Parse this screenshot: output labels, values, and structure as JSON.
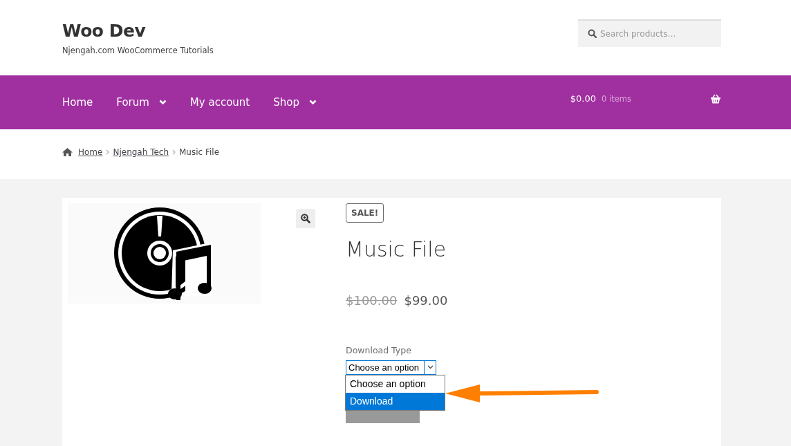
{
  "site": {
    "title": "Woo Dev",
    "tagline": "Njengah.com WooCommerce Tutorials"
  },
  "search": {
    "placeholder": "Search products…"
  },
  "nav": [
    {
      "label": "Home",
      "has_dropdown": false
    },
    {
      "label": "Forum",
      "has_dropdown": true
    },
    {
      "label": "My account",
      "has_dropdown": false
    },
    {
      "label": "Shop",
      "has_dropdown": true
    }
  ],
  "cart": {
    "total": "$0.00",
    "count": "0 items"
  },
  "breadcrumbs": [
    {
      "label": "Home",
      "kind": "link"
    },
    {
      "label": "Njengah Tech",
      "kind": "link"
    },
    {
      "label": "Music File",
      "kind": "current"
    }
  ],
  "product": {
    "badge": "SALE!",
    "title": "Music File",
    "old_price": "$100.00",
    "price": "$99.00",
    "variation": {
      "label": "Download Type",
      "value": "Choose an option",
      "expanded": true,
      "options": [
        {
          "label": "Choose an option",
          "highlighted": false
        },
        {
          "label": "Download",
          "highlighted": true
        }
      ]
    }
  }
}
